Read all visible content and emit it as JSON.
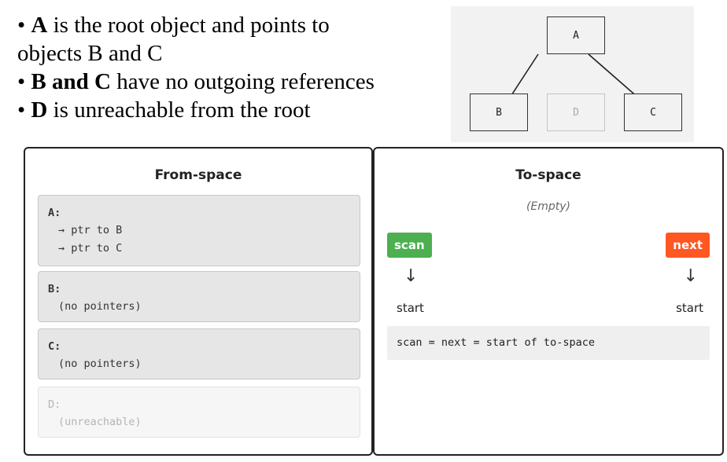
{
  "bullets": [
    {
      "bold": "A",
      "text": " is the root object and points to"
    },
    {
      "bold": "",
      "text": "objects B and C"
    },
    {
      "bold": "B and C",
      "text": " have no outgoing references"
    },
    {
      "bold": "D",
      "text": " is unreachable from the root"
    }
  ],
  "graph": {
    "nodes": {
      "a": "A",
      "b": "B",
      "c": "C",
      "d": "D"
    },
    "edges": [
      [
        "A",
        "B"
      ],
      [
        "A",
        "C"
      ]
    ],
    "unreachable": [
      "D"
    ]
  },
  "from_space": {
    "title": "From-space",
    "objects": [
      {
        "name": "A:",
        "lines": [
          "→ ptr to B",
          "→ ptr to C"
        ]
      },
      {
        "name": "B:",
        "lines": [
          "(no pointers)"
        ]
      },
      {
        "name": "C:",
        "lines": [
          "(no pointers)"
        ]
      },
      {
        "name": "D:",
        "lines": [
          "(unreachable)"
        ],
        "faded": true
      }
    ]
  },
  "to_space": {
    "title": "To-space",
    "empty_label": "(Empty)",
    "scan_label": "scan",
    "next_label": "next",
    "arrow": "↓",
    "start_label": "start",
    "code": "scan = next = start of to-space"
  },
  "colors": {
    "scan": "#4caf50",
    "next": "#ff5722"
  }
}
